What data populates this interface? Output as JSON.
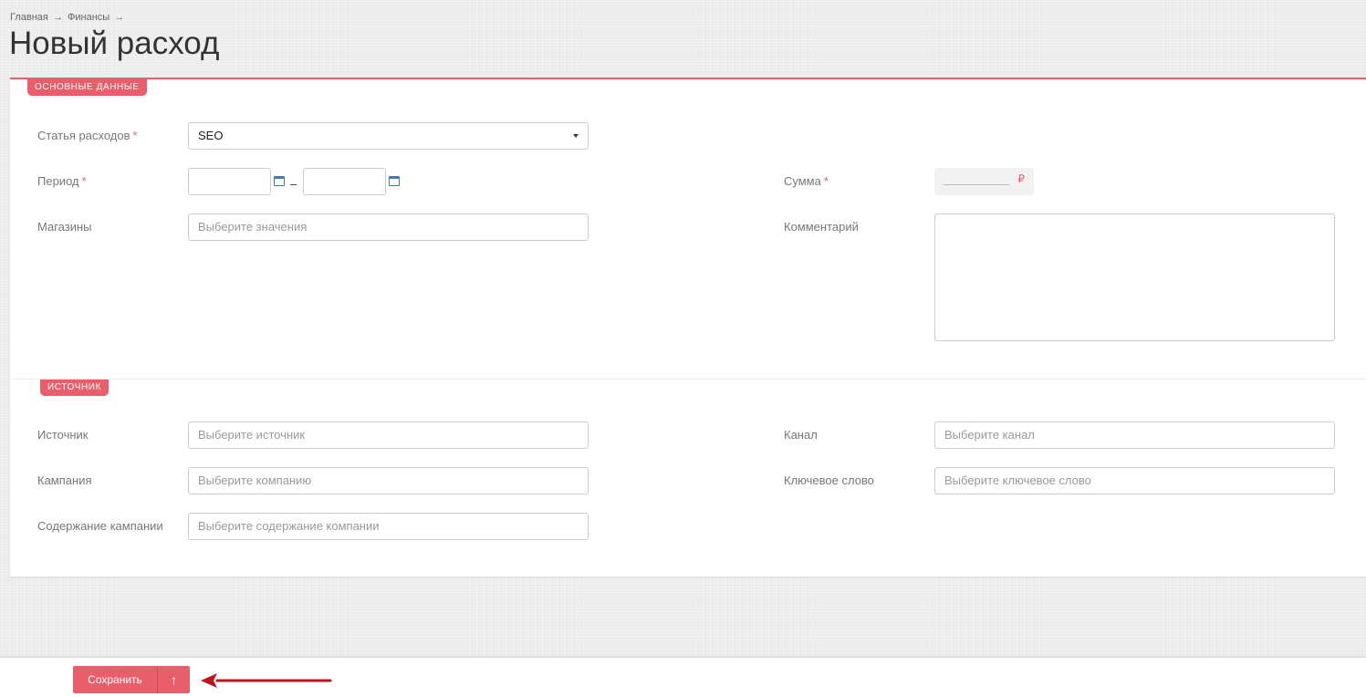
{
  "breadcrumb": {
    "items": [
      "Главная",
      "→",
      "Финансы",
      "→"
    ]
  },
  "page": {
    "title": "Новый расход"
  },
  "sections": {
    "main": {
      "badge": "ОСНОВНЫЕ ДАННЫЕ"
    },
    "source": {
      "badge": "ИСТОЧНИК"
    }
  },
  "form": {
    "required_mark": "*",
    "expense_item": {
      "label": "Статья расходов",
      "value": "SEO"
    },
    "period": {
      "label": "Период",
      "from_value": "",
      "to_value": "",
      "separator": "–"
    },
    "shops": {
      "label": "Магазины",
      "placeholder": "Выберите значения"
    },
    "sum": {
      "label": "Сумма",
      "currency": "₽",
      "value": ""
    },
    "comment": {
      "label": "Комментарий",
      "value": ""
    },
    "source": {
      "label": "Источник",
      "placeholder": "Выберите источник"
    },
    "channel": {
      "label": "Канал",
      "placeholder": "Выберите канал"
    },
    "campaign": {
      "label": "Кампания",
      "placeholder": "Выберите компанию"
    },
    "keyword": {
      "label": "Ключевое слово",
      "placeholder": "Выберите ключевое слово"
    },
    "campaign_content": {
      "label": "Содержание кампании",
      "placeholder": "Выберите содержание компании"
    }
  },
  "footer": {
    "save_label": "Сохранить",
    "up_icon": "↑"
  },
  "colors": {
    "accent": "#e85f6b",
    "calendar_icon": "#3d7ab8",
    "annotation_arrow": "#c0151f"
  }
}
